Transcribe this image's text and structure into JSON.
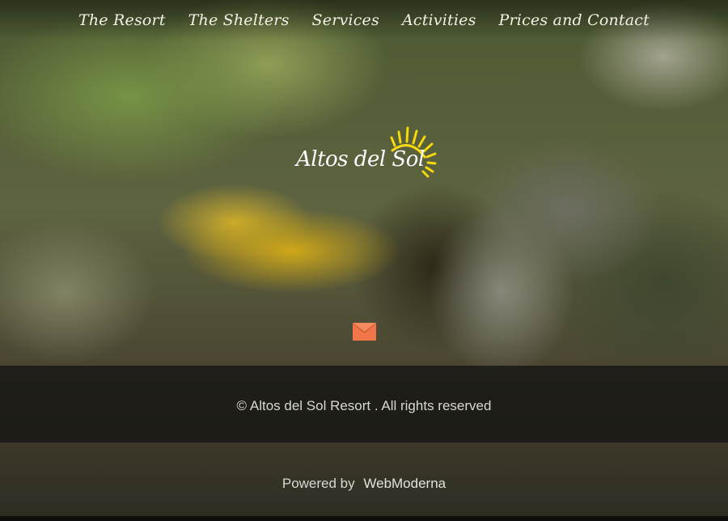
{
  "nav": {
    "items": [
      {
        "label": "The Resort"
      },
      {
        "label": "The Shelters"
      },
      {
        "label": "Services"
      },
      {
        "label": "Activities"
      },
      {
        "label": "Prices and Contact"
      }
    ]
  },
  "logo": {
    "text": "Altos del Sol",
    "sun_color": "#f5d90a"
  },
  "contact": {
    "icon": "mail-icon",
    "icon_color": "#f0764a"
  },
  "footer": {
    "copyright": "© Altos del Sol Resort . All rights reserved",
    "powered_by": "Powered by",
    "powered_by_link": "WebModerna"
  }
}
